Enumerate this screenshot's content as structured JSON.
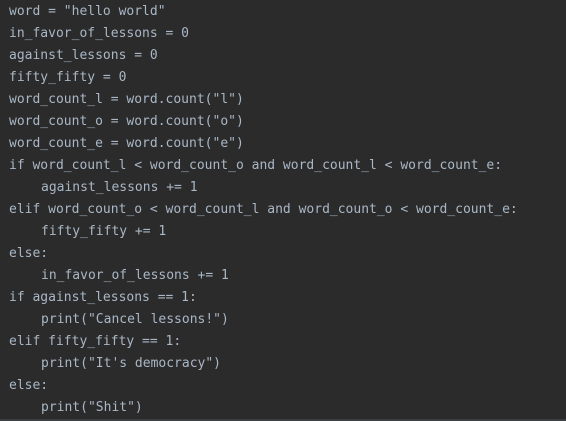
{
  "editor": {
    "lines": [
      "word = \"hello world\"",
      "in_favor_of_lessons = 0",
      "against_lessons = 0",
      "fifty_fifty = 0",
      "word_count_l = word.count(\"l\")",
      "word_count_o = word.count(\"o\")",
      "word_count_e = word.count(\"e\")",
      "if word_count_l < word_count_o and word_count_l < word_count_e:",
      "against_lessons += 1",
      "elif word_count_o < word_count_l and word_count_o < word_count_e:",
      "fifty_fifty += 1",
      "else:",
      "in_favor_of_lessons += 1",
      "if against_lessons == 1:",
      "print(\"Cancel lessons!\")",
      "elif fifty_fifty == 1:",
      "print(\"It's democracy\")",
      "else:",
      "print(\"Shit\")"
    ]
  }
}
